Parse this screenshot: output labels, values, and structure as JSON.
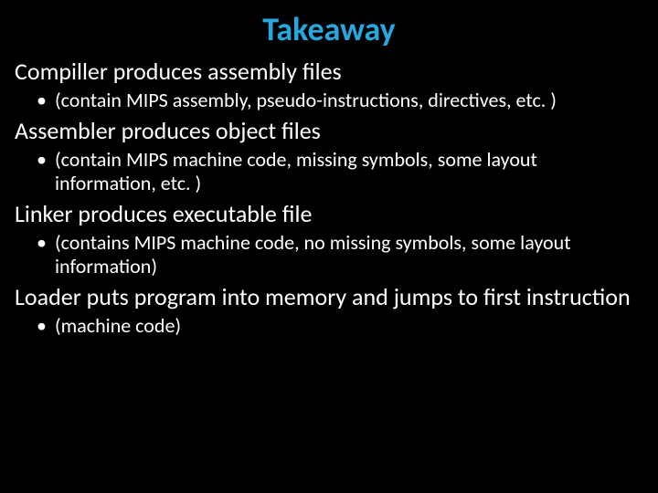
{
  "title": "Takeaway",
  "sections": [
    {
      "heading": "Compiller produces assembly files",
      "bullets": [
        "(contain MIPS assembly, pseudo-instructions, directives, etc. )"
      ]
    },
    {
      "heading": "Assembler produces object files",
      "bullets": [
        "(contain MIPS machine code, missing symbols, some layout information, etc. )"
      ]
    },
    {
      "heading": "Linker produces executable file",
      "bullets": [
        "(contains MIPS machine code, no missing symbols, some layout information)"
      ]
    },
    {
      "heading": "Loader puts program into memory and jumps to first instruction",
      "bullets": [
        "(machine code)"
      ]
    }
  ]
}
